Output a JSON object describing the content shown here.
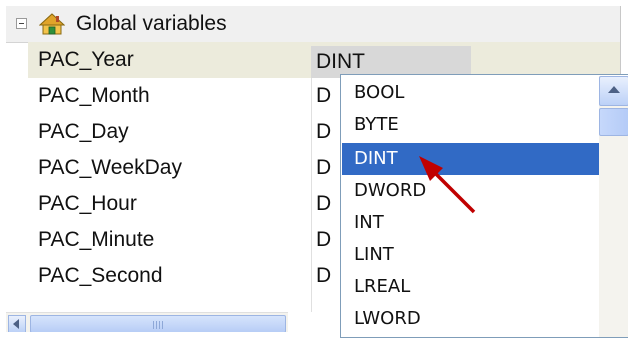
{
  "tree": {
    "title": "Global variables"
  },
  "variables": [
    {
      "name": "PAC_Year",
      "type": "DINT"
    },
    {
      "name": "PAC_Month",
      "type": "D"
    },
    {
      "name": "PAC_Day",
      "type": "D"
    },
    {
      "name": "PAC_WeekDay",
      "type": "D"
    },
    {
      "name": "PAC_Hour",
      "type": "D"
    },
    {
      "name": "PAC_Minute",
      "type": "D"
    },
    {
      "name": "PAC_Second",
      "type": "D"
    }
  ],
  "dropdown": {
    "options": [
      "BOOL",
      "BYTE",
      "DINT",
      "DWORD",
      "INT",
      "LINT",
      "LREAL",
      "LWORD"
    ],
    "highlighted": "DINT"
  },
  "annotation": {
    "arrow_color": "#c00000"
  }
}
